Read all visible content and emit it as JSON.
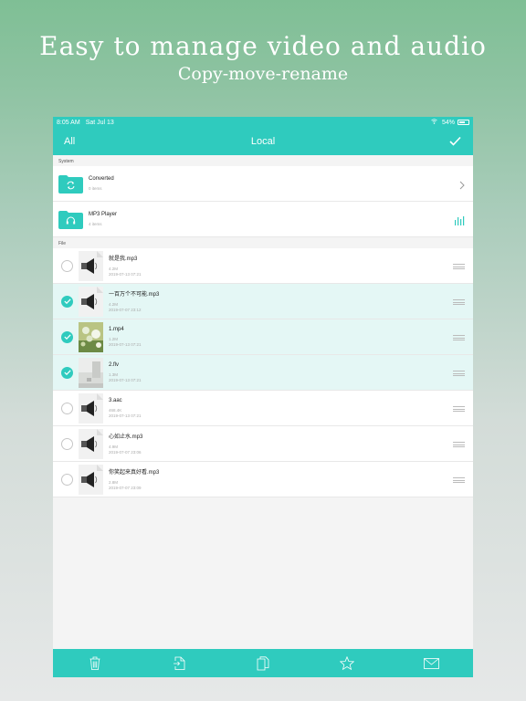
{
  "promo": {
    "headline": "Easy to manage video and audio",
    "subline": "Copy-move-rename"
  },
  "status": {
    "time": "8:05 AM",
    "date": "Sat Jul 13",
    "battery": "54%"
  },
  "nav": {
    "left": "All",
    "title": "Local",
    "right_icon": "checkmark-icon"
  },
  "sections": {
    "system": "System",
    "file": "File"
  },
  "folders": [
    {
      "name": "Converted",
      "count": "0 items",
      "icon": "refresh-folder-icon",
      "right": "chevron-right-icon"
    },
    {
      "name": "MP3 Player",
      "count": "4 items",
      "icon": "headphones-folder-icon",
      "right": "equalizer-icon"
    }
  ],
  "files": [
    {
      "name": "就是我.mp3",
      "size": "4.2M",
      "date": "2019-07-13 07:21",
      "selected": false,
      "thumb": "speaker"
    },
    {
      "name": "一百万个不可能.mp3",
      "size": "4.2M",
      "date": "2019-07-07 23:12",
      "selected": true,
      "thumb": "speaker"
    },
    {
      "name": "1.mp4",
      "size": "1.2M",
      "date": "2019-07-13 07:21",
      "selected": true,
      "thumb": "flowers"
    },
    {
      "name": "2.flv",
      "size": "1.3M",
      "date": "2019-07-13 07:21",
      "selected": true,
      "thumb": "room"
    },
    {
      "name": "3.aac",
      "size": "468.4K",
      "date": "2019-07-13 07:21",
      "selected": false,
      "thumb": "speaker"
    },
    {
      "name": "心如止水.mp3",
      "size": "4.9M",
      "date": "2019-07-07 23:06",
      "selected": false,
      "thumb": "speaker"
    },
    {
      "name": "你笑起来真好看.mp3",
      "size": "2.8M",
      "date": "2019-07-07 23:09",
      "selected": false,
      "thumb": "speaker"
    }
  ],
  "toolbar": [
    "trash-icon",
    "move-icon",
    "copy-icon",
    "star-icon",
    "mail-icon"
  ],
  "colors": {
    "accent": "#2fcbbe",
    "selected_row": "#e4f7f5"
  }
}
